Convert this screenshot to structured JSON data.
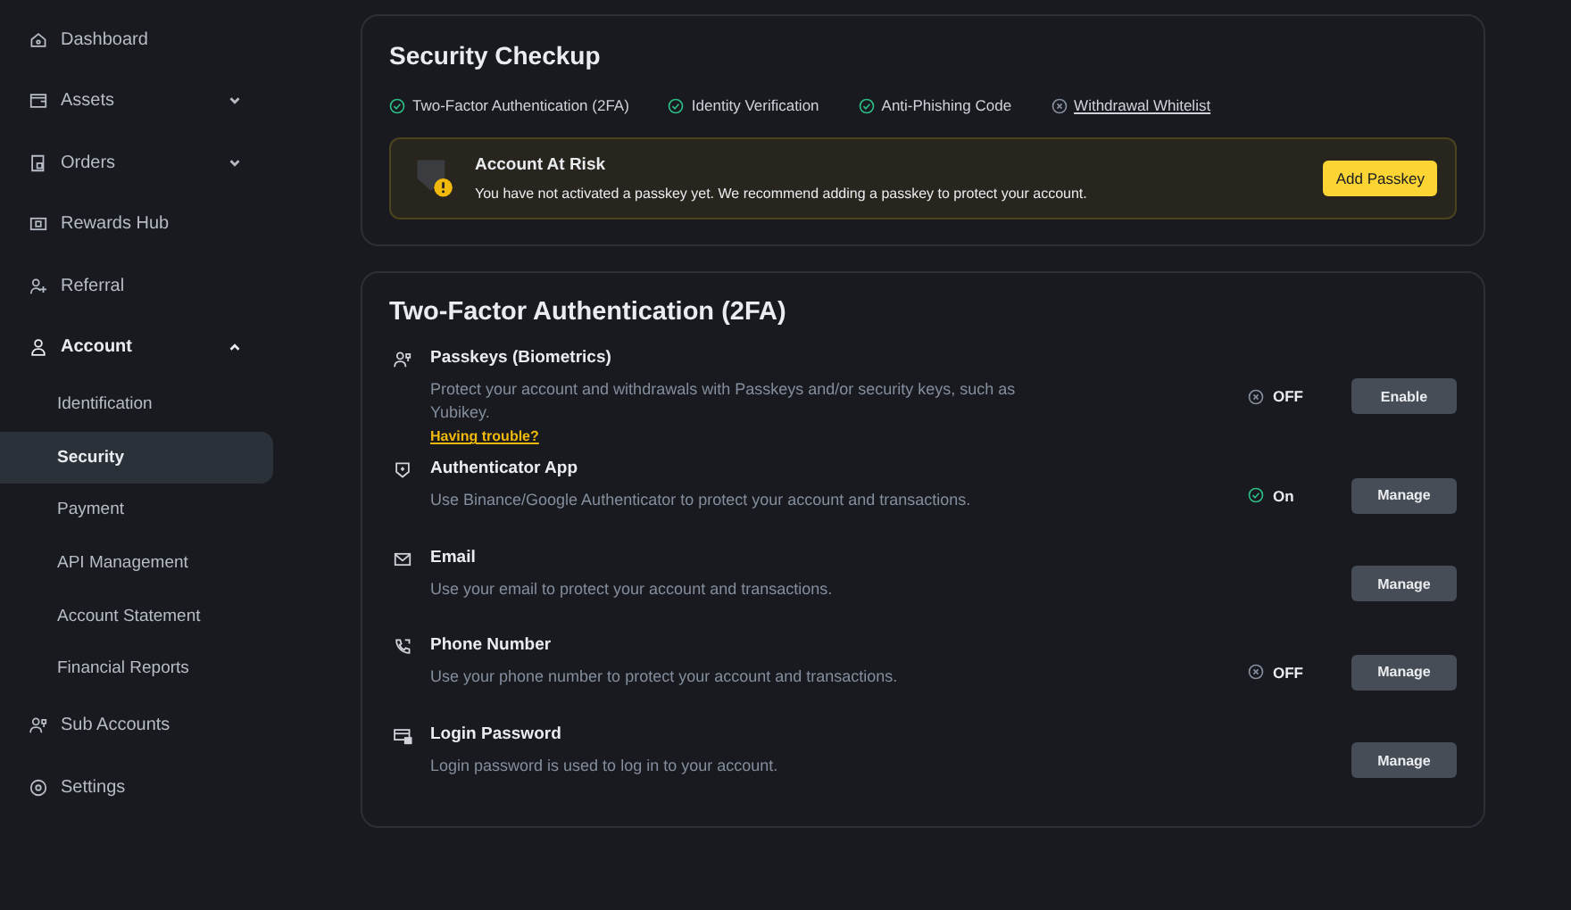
{
  "sidebar": {
    "items": [
      {
        "label": "Dashboard",
        "kind": "home"
      },
      {
        "label": "Assets",
        "kind": "wallet",
        "expanded": false
      },
      {
        "label": "Orders",
        "kind": "doc",
        "expanded": false
      },
      {
        "label": "Rewards Hub",
        "kind": "ticket"
      },
      {
        "label": "Referral",
        "kind": "useradd"
      },
      {
        "label": "Account",
        "kind": "user",
        "expanded": true,
        "children": [
          {
            "label": "Identification",
            "selected": false
          },
          {
            "label": "Security",
            "selected": true
          },
          {
            "label": "Payment",
            "selected": false
          },
          {
            "label": "API Management",
            "selected": false
          },
          {
            "label": "Account Statement",
            "selected": false
          },
          {
            "label": "Financial Reports",
            "selected": false
          }
        ]
      },
      {
        "label": "Sub Accounts",
        "kind": "users"
      },
      {
        "label": "Settings",
        "kind": "gear"
      }
    ]
  },
  "security_checkup": {
    "title": "Security Checkup",
    "checks": [
      {
        "label": "Two-Factor Authentication (2FA)",
        "done": true
      },
      {
        "label": "Identity Verification",
        "done": true
      },
      {
        "label": "Anti-Phishing Code",
        "done": true
      },
      {
        "label": "Withdrawal Whitelist",
        "done": false
      }
    ],
    "alert": {
      "title": "Account At Risk",
      "message": "You have not activated a passkey yet. We recommend adding a passkey to protect your account.",
      "button": "Add Passkey"
    }
  },
  "two_factor": {
    "title": "Two-Factor Authentication (2FA)",
    "methods": [
      {
        "kind": "passkey",
        "title": "Passkeys (Biometrics)",
        "description": "Protect your account and withdrawals with Passkeys and/or security keys, such as Yubikey.",
        "link": "Having trouble?",
        "status": "OFF",
        "enabled": false,
        "button": "Enable"
      },
      {
        "kind": "shield",
        "title": "Authenticator App",
        "description": "Use Binance/Google Authenticator to protect your account and transactions.",
        "status": "On",
        "enabled": true,
        "button": "Manage"
      },
      {
        "kind": "mail",
        "title": "Email",
        "description": "Use your email to protect your account and transactions.",
        "button": "Manage"
      },
      {
        "kind": "phone",
        "title": "Phone Number",
        "description": "Use your phone number to protect your account and transactions.",
        "status": "OFF",
        "enabled": false,
        "button": "Manage"
      },
      {
        "kind": "password",
        "title": "Login Password",
        "description": "Login password is used to log in to your account.",
        "button": "Manage"
      }
    ]
  }
}
